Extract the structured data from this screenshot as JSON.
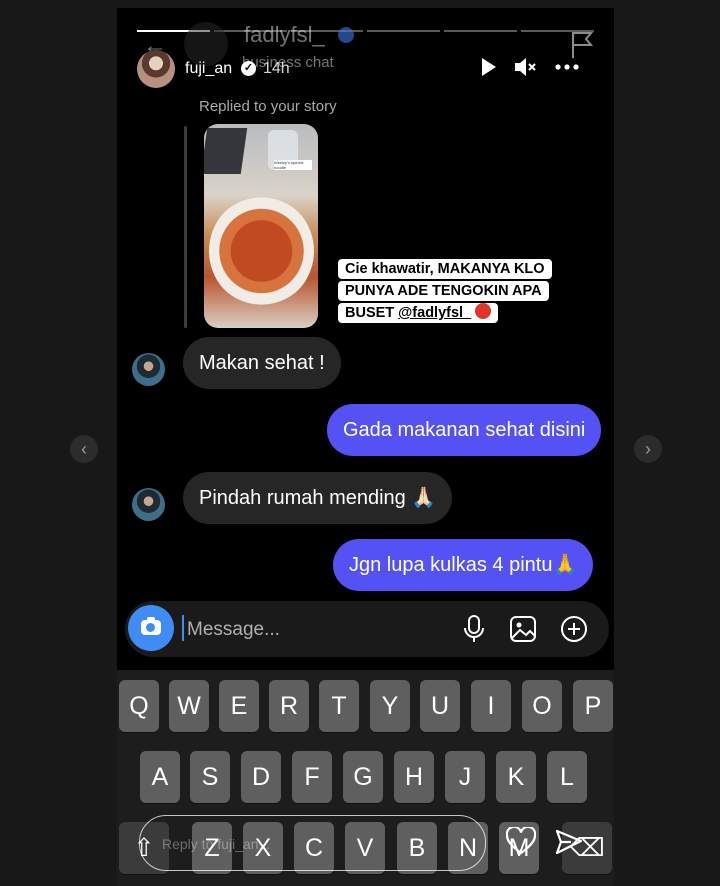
{
  "story": {
    "username": "fuji_an",
    "time": "14h",
    "ghost_username": "fadlyfsl_",
    "ghost_subtitle": "business chat",
    "replied_label": "Replied to your story",
    "thumb_label": "Wesley's special noodle",
    "caption_line1": "Cie khawatir, MAKANYA KLO",
    "caption_line2": "PUNYA ADE TENGOKIN APA",
    "caption_line3": "BUSET ",
    "caption_mention": "@fadlyfsl_",
    "progress_segments": 6,
    "progress_done": 1
  },
  "messages": [
    {
      "direction": "incoming",
      "text": "Makan sehat !"
    },
    {
      "direction": "outgoing",
      "text": "Gada makanan sehat disini"
    },
    {
      "direction": "incoming",
      "text": "Pindah rumah mending 🙏🏻"
    },
    {
      "direction": "outgoing",
      "text": "Jgn lupa kulkas 4 pintu🙏"
    }
  ],
  "composer": {
    "placeholder": "Message..."
  },
  "keyboard": {
    "row1": [
      "Q",
      "W",
      "E",
      "R",
      "T",
      "Y",
      "U",
      "I",
      "O",
      "P"
    ],
    "row2": [
      "A",
      "S",
      "D",
      "F",
      "G",
      "H",
      "J",
      "K",
      "L"
    ],
    "row3": [
      "Z",
      "X",
      "C",
      "V",
      "B",
      "N",
      "M"
    ]
  },
  "story_reply": {
    "placeholder": "Reply to fuji_an..."
  },
  "colors": {
    "outgoing_bubble": "#5552f5",
    "incoming_bubble": "#262626",
    "camera_button": "#3f8cf6"
  }
}
